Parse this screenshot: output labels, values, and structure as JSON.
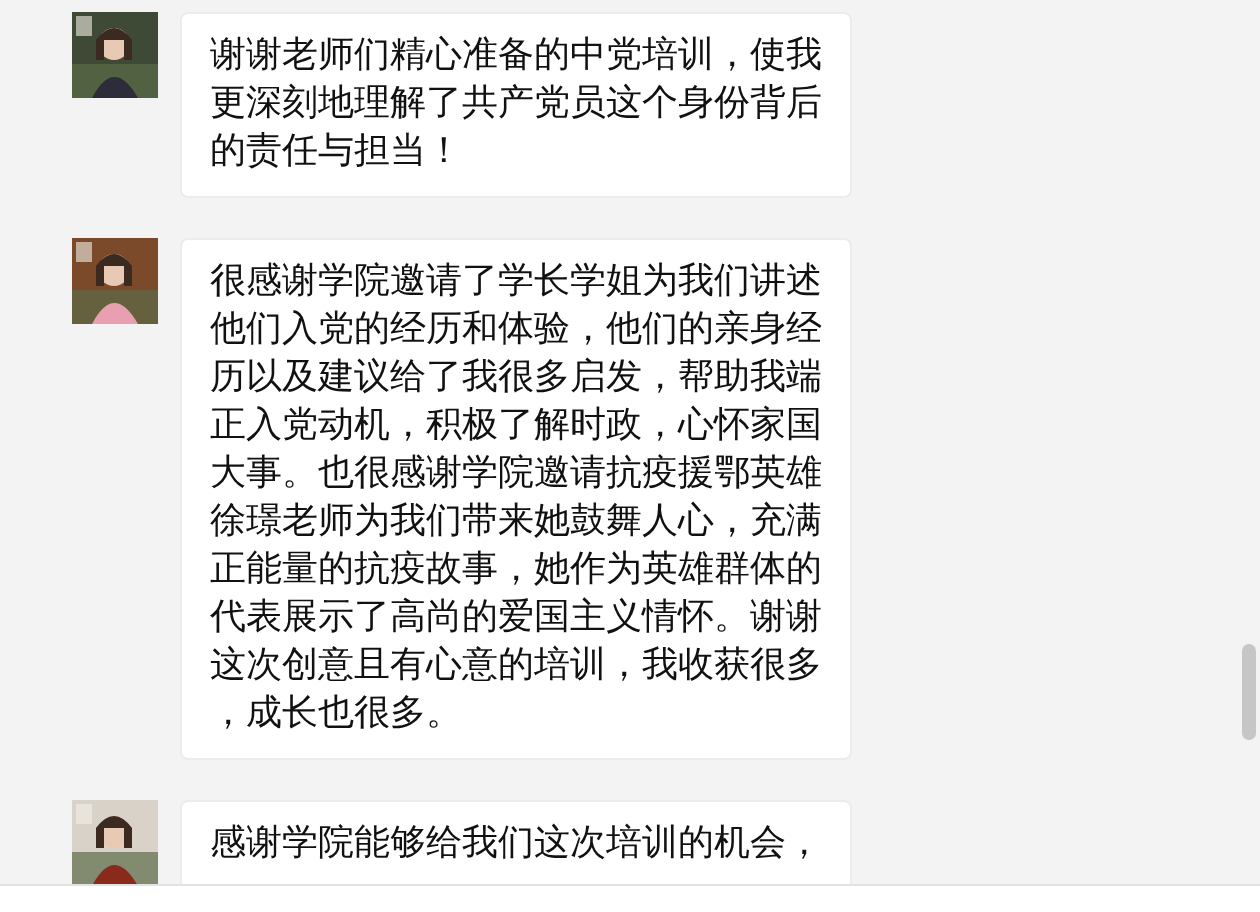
{
  "messages": [
    {
      "text": "谢谢老师们精心准备的中党培训，使我更深刻地理解了共产党员这个身份背后的责任与担当！"
    },
    {
      "text": "很感谢学院邀请了学长学姐为我们讲述他们入党的经历和体验，他们的亲身经历以及建议给了我很多启发，帮助我端正入党动机，积极了解时政，心怀家国大事。也很感谢学院邀请抗疫援鄂英雄徐璟老师为我们带来她鼓舞人心，充满正能量的抗疫故事，她作为英雄群体的代表展示了高尚的爱国主义情怀。谢谢这次创意且有心意的培训，我收获很多，成长也很多。"
    },
    {
      "text": "感谢学院能够给我们这次培训的机会，"
    }
  ]
}
